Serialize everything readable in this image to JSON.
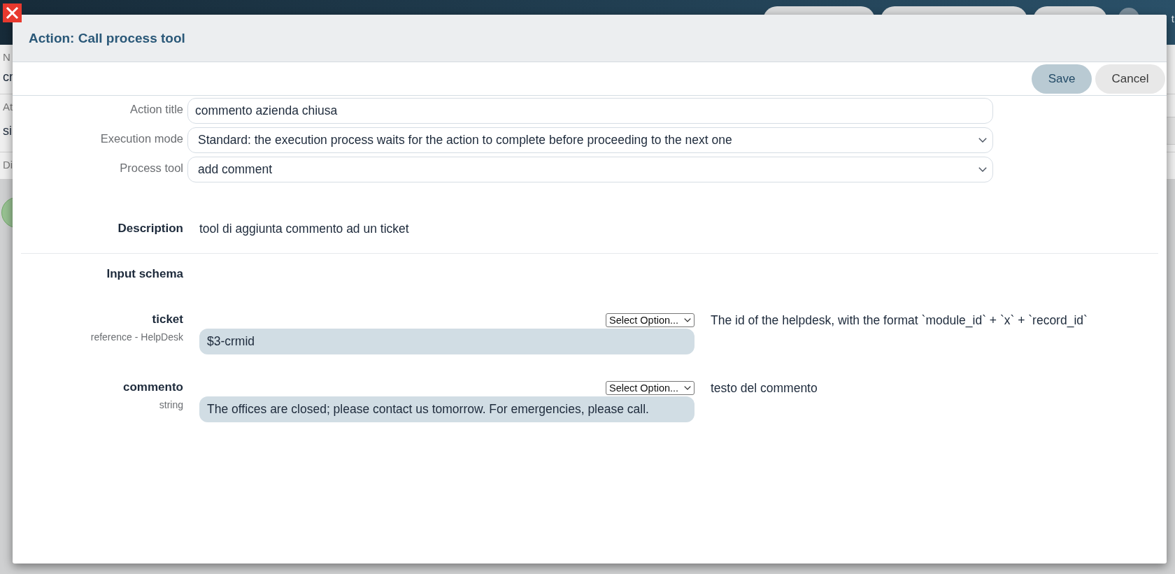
{
  "background_page": {
    "top_bar": {
      "text": "t"
    },
    "fields": [
      {
        "label": "N",
        "value": "cr"
      },
      {
        "label": "At",
        "value": "si"
      },
      {
        "label": "Di"
      }
    ]
  },
  "dialog": {
    "title": "Action: Call process tool",
    "buttons": [
      {
        "label": "Save",
        "kind": "primary"
      },
      {
        "label": "Cancel",
        "kind": "secondary"
      }
    ],
    "fields": [
      {
        "label": "Action title",
        "kind": "text",
        "value": "commento azienda chiusa"
      },
      {
        "label": "Execution mode",
        "kind": "select",
        "value": "Standard: the execution process waits for the action to complete before proceeding to the next one"
      },
      {
        "label": "Process tool",
        "kind": "select",
        "value": "add comment"
      }
    ],
    "description": {
      "label": "Description",
      "value": "tool di aggiunta commento ad un ticket"
    },
    "input_schema": {
      "label": "Input schema",
      "parameters": [
        {
          "name": "ticket",
          "type": "reference - HelpDesk",
          "option_select": "Select Option...",
          "value": "$3-crmid",
          "help": "The id of the helpdesk, with the format `module_id` + `x` + `record_id`"
        },
        {
          "name": "commento",
          "type": "string",
          "option_select": "Select Option...",
          "value": "The offices are closed; please contact us tomorrow. For emergencies, please call.",
          "help": "testo del commento"
        }
      ]
    }
  }
}
